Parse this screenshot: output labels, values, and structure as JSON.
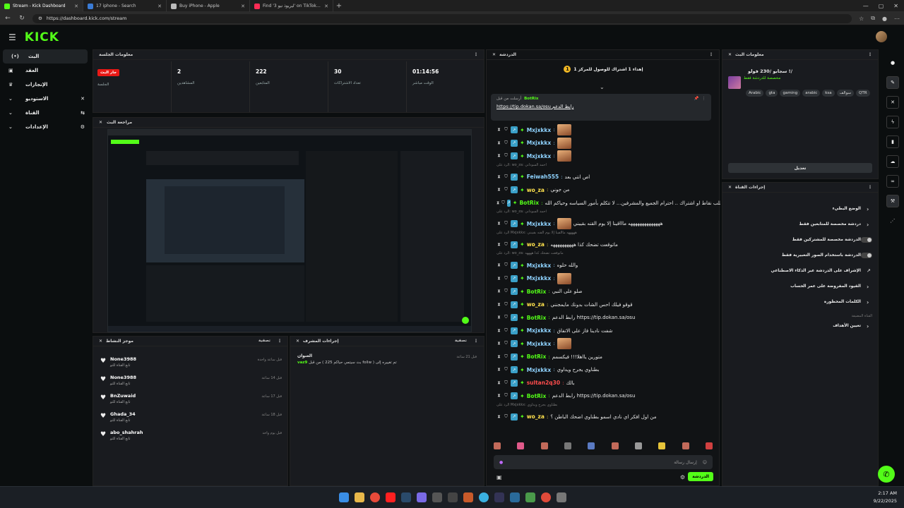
{
  "browser": {
    "tabs": [
      {
        "title": "Stream - Kick Dashboard",
        "active": true,
        "color": "#53fc18"
      },
      {
        "title": "17 iphone - Search",
        "active": false,
        "color": "#3a7bd5"
      },
      {
        "title": "Buy iPhone - Apple",
        "active": false,
        "color": "#bbbbbb"
      },
      {
        "title": "Find 'ليريوذ نيو 3' on TikTok | TikTok",
        "active": false,
        "color": "#ff2c55"
      }
    ],
    "url": "https://dashboard.kick.com/stream"
  },
  "app": {
    "logo": "KICK",
    "brand_color": "#53fc18"
  },
  "leftnav": [
    {
      "label": "البث",
      "icon": "(•)",
      "icon_name": "live-icon",
      "active": true
    },
    {
      "label": "العقد",
      "icon": "▣",
      "icon_name": "contract-icon",
      "active": false
    },
    {
      "label": "الإنجازات",
      "icon": "🏆",
      "icon_name": "trophy-icon",
      "active": false
    },
    {
      "label": "الاستوديو",
      "icon": "⚙",
      "icon_name": "studio-icon",
      "active": false
    },
    {
      "label": "القناة",
      "icon": "⇆",
      "icon_name": "channel-icon",
      "active": false
    },
    {
      "label": "الإعدادات",
      "icon": "⚙",
      "icon_name": "settings-icon",
      "active": false
    }
  ],
  "session": {
    "title": "معلومات الجلسة",
    "stats": [
      {
        "value": "جار البث",
        "label": "الجلسة",
        "badge": true
      },
      {
        "value": "2",
        "label": "المشاهدين"
      },
      {
        "value": "222",
        "label": "المتابعين"
      },
      {
        "value": "30",
        "label": "تعداد الاشتراكات"
      },
      {
        "value": "01:14:56",
        "label": "الوقت مباشر"
      }
    ]
  },
  "preview": {
    "title": "مراجعة البث"
  },
  "activity": {
    "title": "موجز النشاط",
    "filter": "تصفية",
    "items": [
      {
        "name": "None3988",
        "sub": "تابع القناة للتو",
        "time": "قبل ساعة واحدة"
      },
      {
        "name": "None3988",
        "sub": "تابع القناة للتو",
        "time": "قبل 14 ساعة"
      },
      {
        "name": "BnZuwaid",
        "sub": "تابع القناة للتو",
        "time": "قبل 17 ساعة"
      },
      {
        "name": "Ghada_34",
        "sub": "تابع القناة للتو",
        "time": "قبل 18 ساعة"
      },
      {
        "name": "abo_shahrah",
        "sub": "تابع القناة للتو",
        "time": "قبل يوم واحد"
      }
    ]
  },
  "modactions": {
    "title": "إجراءات المشرف",
    "filter": "تصفية",
    "header": "العنوان",
    "items": [
      {
        "user": "vaz9",
        "text": "من قبل ( بث سيتمي حياكم 225 follw ) تم تغييره إلى",
        "time": "قبل 21 ساعة"
      }
    ]
  },
  "chat": {
    "title": "الدردشة",
    "goal": "إهداء 1 اشتراك للوصول للمركز 1",
    "pinned": {
      "by": "BotRix",
      "label": "أرسلت من قبل",
      "text": "رابط الدعم",
      "url": "https://tip.dokan.sa/osu"
    },
    "messages": [
      {
        "user": "Mxjxkkx",
        "color": "#8fd3ff",
        "text": "",
        "emote": true
      },
      {
        "user": "Mxjxkkx",
        "color": "#8fd3ff",
        "text": "",
        "emote": true
      },
      {
        "user": "Mxjxkkx",
        "color": "#8fd3ff",
        "text": "",
        "emote": true
      },
      {
        "reply": "الرد على: wo_za: احمد السوداني"
      },
      {
        "user": "Feiwah555",
        "color": "#8fd3ff",
        "text": "اص انتي بعد"
      },
      {
        "user": "wo_za",
        "color": "#ffe14d",
        "text": "من جوني"
      },
      {
        "user": "BotRix",
        "color": "#53fc18",
        "text": "البث: لا تسب لاتطلب نقاط او اشتراك .. احترام الجميع والمشرفين... لا تتكلم بأمور السياسه وحياكم الله 💗"
      },
      {
        "reply": "الرد على: wo_za: احمد السوداني"
      },
      {
        "user": "Mxjxkkx",
        "color": "#8fd3ff",
        "text": "ههههههههههههههه ماااقينا إلا يوم القنه بقيبني",
        "emote": true
      },
      {
        "reply": "الرد على Mxjxkkx: هههههه ماالقينا إلا يوم القنه بقيبني"
      },
      {
        "user": "wo_za",
        "color": "#ffe14d",
        "text": "ماتوقعت تضحك كذا ههههههههههه"
      },
      {
        "reply": "الرد على: wo_za: ماتوقعت تضحك كذا ههههه"
      },
      {
        "user": "Mxjxkkx",
        "color": "#8fd3ff",
        "text": "والله حلوه"
      },
      {
        "user": "Mxjxkkx",
        "color": "#8fd3ff",
        "text": "",
        "emote": true
      },
      {
        "user": "BotRix",
        "color": "#53fc18",
        "text": "صلو على النبي"
      },
      {
        "user": "wo_za",
        "color": "#ffe14d",
        "text": "قوقو فيلك احس الشات بدونك مايمجنني"
      },
      {
        "user": "BotRix",
        "color": "#53fc18",
        "text": "رابط الدعم https://tip.dokan.sa/osu"
      },
      {
        "user": "Mxjxkkx",
        "color": "#8fd3ff",
        "text": "شفت نادينا فاز على الاتفاق"
      },
      {
        "user": "Mxjxkkx",
        "color": "#8fd3ff",
        "text": "",
        "emote": true
      },
      {
        "user": "BotRix",
        "color": "#53fc18",
        "text": "متورين يااهلا!!! فيكسمم"
      },
      {
        "user": "Mxjxkkx",
        "color": "#8fd3ff",
        "text": "بطناوي يجرح ويداوي"
      },
      {
        "user": "sultan2q30",
        "color": "#ff4d4d",
        "text": "بالك"
      },
      {
        "user": "BotRix",
        "color": "#53fc18",
        "text": "رابط الدعم https://tip.dokan.sa/osu"
      },
      {
        "reply": "الرد على Mxjxkkx: بطناوي يجرح ويداوي"
      },
      {
        "user": "wo_za",
        "color": "#ffe14d",
        "text": "من اول افكر اي نادي اسمو بطناوي اضحك الباطن ؟"
      }
    ],
    "placeholder": "إرسال رسالة",
    "send": "الدردشة"
  },
  "streaminfo": {
    "title": "معلومات البث",
    "stream_title": "سجابو /230 فولو !/",
    "category": "مخصصة للدردشة فقط",
    "tags": [
      "Arabic",
      "gta",
      "gaming",
      "arabic",
      "ksa",
      "سوالف",
      "QTR"
    ],
    "edit": "تعديل"
  },
  "chanact": {
    "title": "إجراءات القناة",
    "rows": [
      {
        "label": "الوضع البطيء",
        "type": "arrow"
      },
      {
        "label": "دردشة مخصصة للمتابعين فقط",
        "type": "arrow"
      },
      {
        "label": "الدردشة مخصصة للمشتركين فقط",
        "type": "toggle"
      },
      {
        "label": "الدردشة باستخدام الصور التعبيرية فقط",
        "type": "toggle"
      },
      {
        "label": "الإشراف على الدردشة عبر الذكاء الاصطناعي",
        "type": "ext"
      },
      {
        "label": "القيود المفروضة على عمر الحساب",
        "type": "arrow"
      },
      {
        "label": "الكلمات المحظورة",
        "type": "arrow"
      }
    ],
    "section": "القناة المضيفة",
    "host_row": "تعيين الأهداف"
  },
  "tray": {
    "time": "2:17 AM",
    "date": "9/22/2025"
  }
}
